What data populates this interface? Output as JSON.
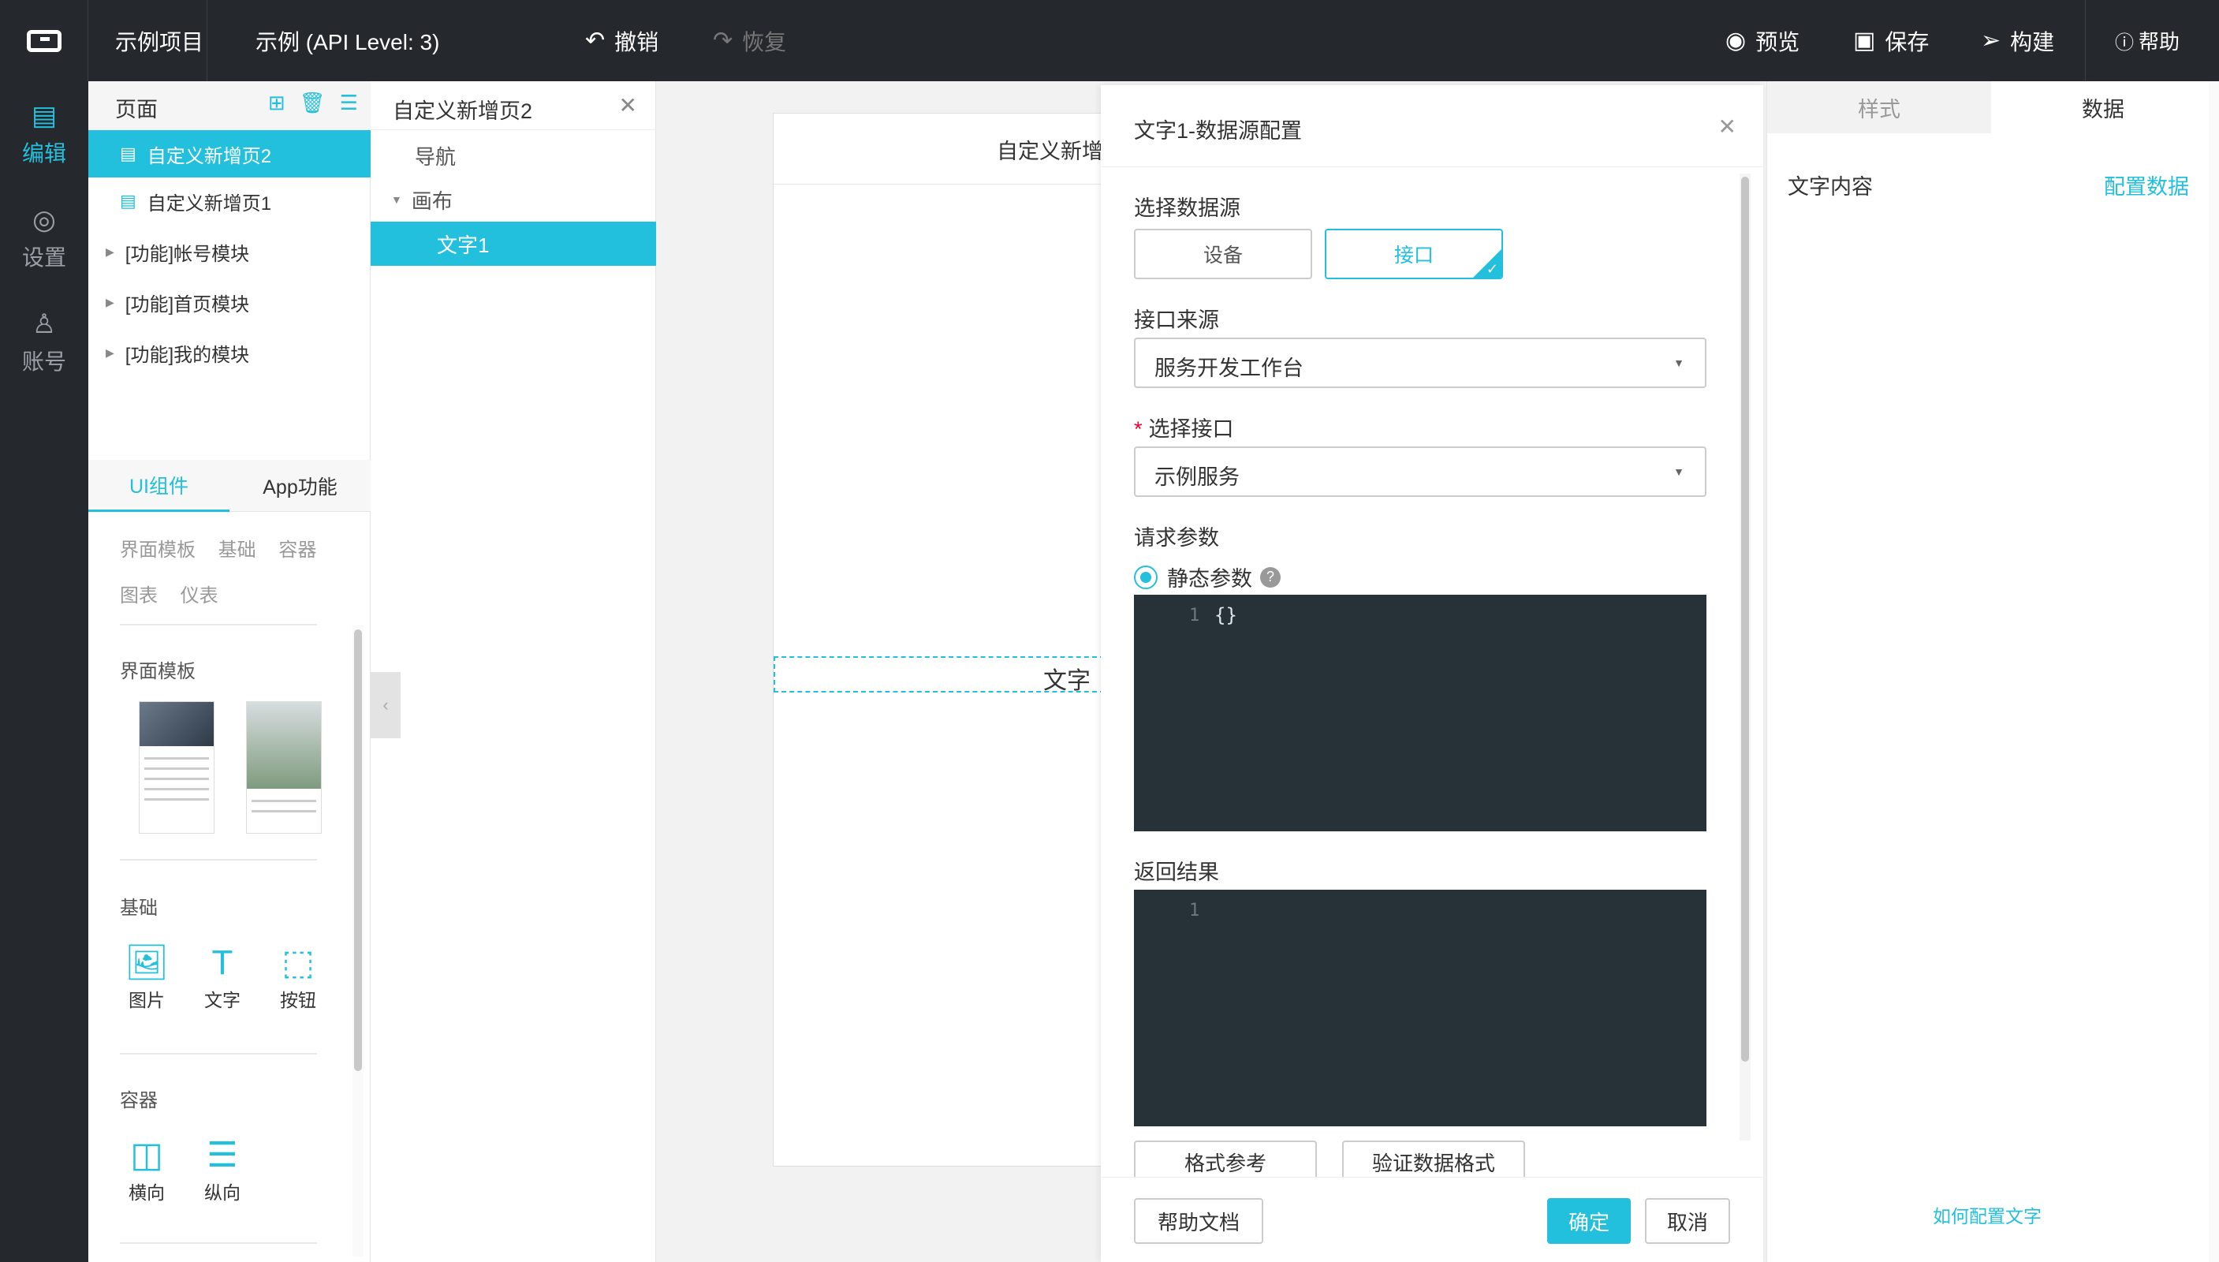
{
  "topbar": {
    "project": "示例项目",
    "app_name": "示例 (API Level: 3)",
    "undo": "撤销",
    "redo": "恢复",
    "preview": "预览",
    "save": "保存",
    "build": "构建",
    "help": "帮助"
  },
  "rail": {
    "edit": "编辑",
    "settings": "设置",
    "account": "账号"
  },
  "pages": {
    "title": "页面",
    "items": [
      {
        "label": "自定义新增页2",
        "active": true
      },
      {
        "label": "自定义新增页1",
        "active": false
      }
    ],
    "modules": [
      "[功能]帐号模块",
      "[功能]首页模块",
      "[功能]我的模块"
    ]
  },
  "components": {
    "tabs": [
      "UI组件",
      "App功能"
    ],
    "categories_row1": "界面模板 基础 容器",
    "categories_row2": "图表 仪表",
    "section_templates": "界面模板",
    "section_basic": "基础",
    "basic_items": [
      "图片",
      "文字",
      "按钮"
    ],
    "section_container": "容器",
    "container_items": [
      "横向",
      "纵向"
    ]
  },
  "outline": {
    "title": "自定义新增页2",
    "nodes": [
      "导航",
      "画布",
      "文字1"
    ]
  },
  "canvas": {
    "phone_nav_title": "自定义新增",
    "phone_text": "文字"
  },
  "dialog": {
    "title": "文字1-数据源配置",
    "datasource_label": "选择数据源",
    "datasource_options": [
      "设备",
      "接口"
    ],
    "datasource_selected": "接口",
    "api_source_label": "接口来源",
    "api_source_value": "服务开发工作台",
    "select_api_label": "选择接口",
    "select_api_value": "示例服务",
    "request_params_label": "请求参数",
    "static_params_label": "静态参数",
    "request_line_no": "1",
    "request_code": "{}",
    "response_label": "返回结果",
    "response_line_no": "1",
    "format_ref_button": "格式参考",
    "validate_button": "验证数据格式",
    "help_doc_button": "帮助文档",
    "confirm_button": "确定",
    "cancel_button": "取消"
  },
  "props": {
    "tabs": [
      "样式",
      "数据"
    ],
    "active_tab": "数据",
    "text_content_label": "文字内容",
    "config_data_link": "配置数据",
    "how_to_link": "如何配置文字"
  },
  "colors": {
    "accent": "#23c0dd",
    "topbar_bg": "#25292e",
    "editor_bg": "#263238"
  }
}
